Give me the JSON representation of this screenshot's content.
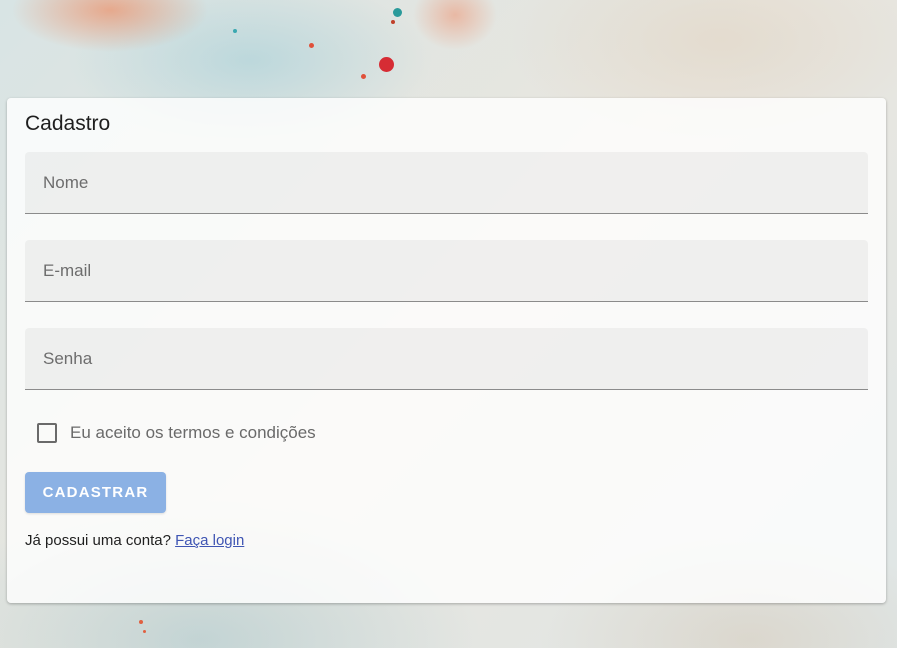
{
  "form": {
    "title": "Cadastro",
    "fields": {
      "name": {
        "placeholder": "Nome",
        "value": ""
      },
      "email": {
        "placeholder": "E-mail",
        "value": ""
      },
      "password": {
        "placeholder": "Senha",
        "value": ""
      }
    },
    "terms": {
      "label": "Eu aceito os termos e condições",
      "checked": false
    },
    "submit_label": "CADASTRAR",
    "login_prompt": "Já possui uma conta?",
    "login_link": "Faça login"
  },
  "colors": {
    "button": "#8bb1e4",
    "link": "#3f55b3",
    "card": "#ffffff"
  }
}
